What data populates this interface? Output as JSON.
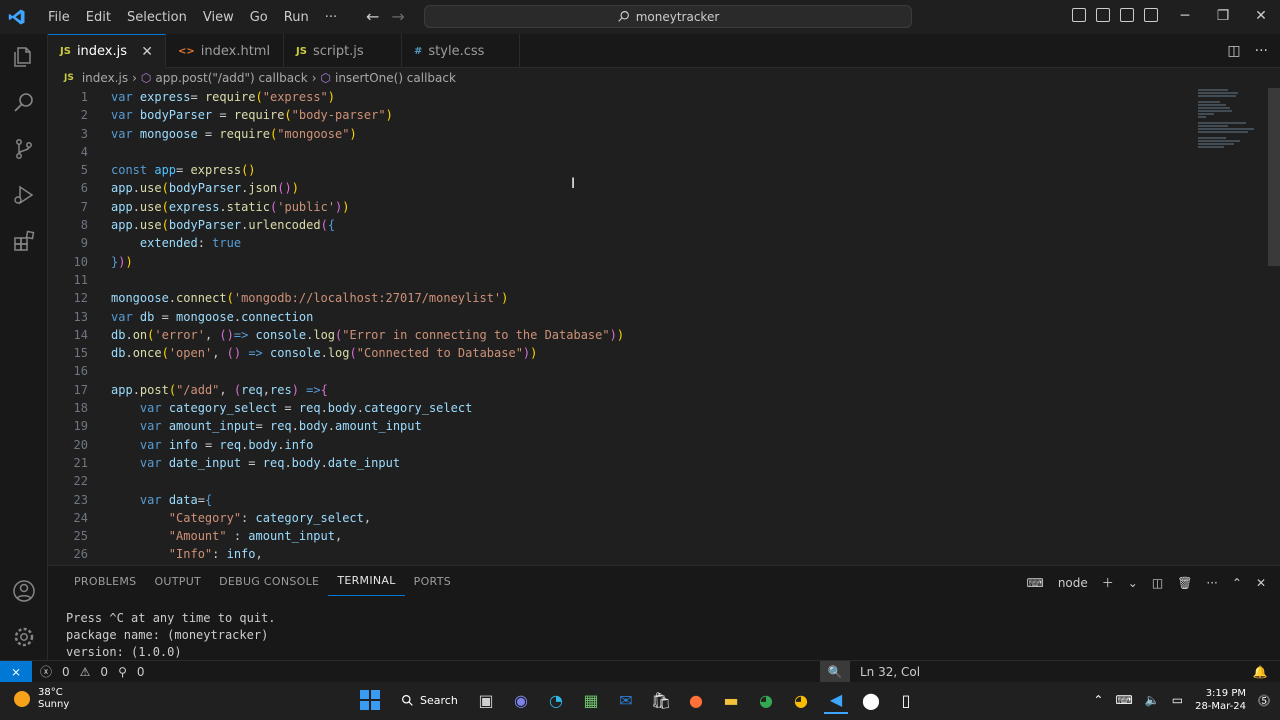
{
  "titlebar": {
    "menu": [
      "File",
      "Edit",
      "Selection",
      "View",
      "Go",
      "Run",
      "···"
    ],
    "search_text": "moneytracker"
  },
  "tabs": [
    {
      "label": "index.js",
      "icon": "JS",
      "active": true
    },
    {
      "label": "index.html",
      "icon": "<>",
      "active": false
    },
    {
      "label": "script.js",
      "icon": "JS",
      "active": false
    },
    {
      "label": "style.css",
      "icon": "#",
      "active": false
    }
  ],
  "breadcrumb": {
    "file": "index.js",
    "file_icon": "JS",
    "item1": "app.post(\"/add\") callback",
    "item2": "insertOne() callback"
  },
  "editor": {
    "line_numbers": [
      "1",
      "2",
      "3",
      "4",
      "5",
      "6",
      "7",
      "8",
      "9",
      "10",
      "11",
      "12",
      "13",
      "14",
      "15",
      "16",
      "17",
      "18",
      "19",
      "20",
      "21",
      "22",
      "23",
      "24",
      "25",
      "26"
    ]
  },
  "panel": {
    "tabs": [
      "PROBLEMS",
      "OUTPUT",
      "DEBUG CONSOLE",
      "TERMINAL",
      "PORTS"
    ],
    "active_tab": "TERMINAL",
    "terminal_name": "node",
    "terminal_lines": [
      "Press ^C at any time to quit.",
      "package name: (moneytracker)",
      "version: (1.0.0)"
    ]
  },
  "statusbar": {
    "errors": "0",
    "warnings": "0",
    "ports": "0",
    "position": "Ln 32, Col"
  },
  "taskbar": {
    "temperature": "38°C",
    "weather": "Sunny",
    "search_label": "Search",
    "time": "3:19 PM",
    "date": "28-Mar-24"
  },
  "colors": {
    "accent": "#0078d4",
    "keyword": "#569cd6",
    "string": "#ce9178",
    "function": "#dcdcaa",
    "variable": "#9cdcfe"
  }
}
